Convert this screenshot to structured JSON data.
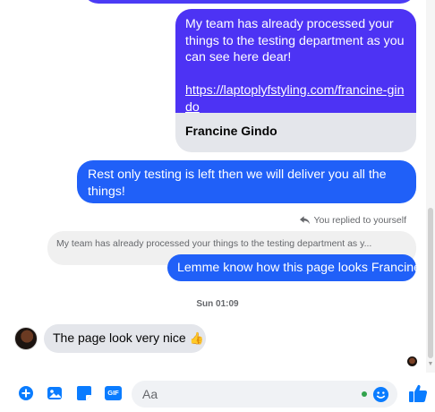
{
  "messages": {
    "link_message": {
      "text": "My team has already processed your things to the testing department as you can see here dear!",
      "url": "https://laptoplyfstyling.com/francine-gindo",
      "preview_title": "Francine Gindo"
    },
    "message_2": "Rest only testing is left then we will deliver you all the things!",
    "replied_note": "You replied to yourself",
    "quoted_text": "My team has already processed your things to the testing department as y...",
    "reply_message": "Lemme know how this page looks Francine.",
    "timestamp": "Sun 01:09",
    "incoming_message": "The page look very nice",
    "incoming_emoji": "👍"
  },
  "composer": {
    "placeholder": "Aa"
  },
  "icons": {
    "toolbar": [
      "plus-icon",
      "photo-icon",
      "sticker-icon",
      "gif-icon"
    ],
    "gif_label": "GIF",
    "emoji": "emoji-icon",
    "like": "thumbs-up-icon"
  },
  "colors": {
    "accent": "#0a7cff",
    "outgoing_top": "#4d33f4",
    "outgoing_bottom": "#2060f8",
    "incoming_bubble": "#e4e6eb",
    "online_dot": "#31a24c"
  }
}
